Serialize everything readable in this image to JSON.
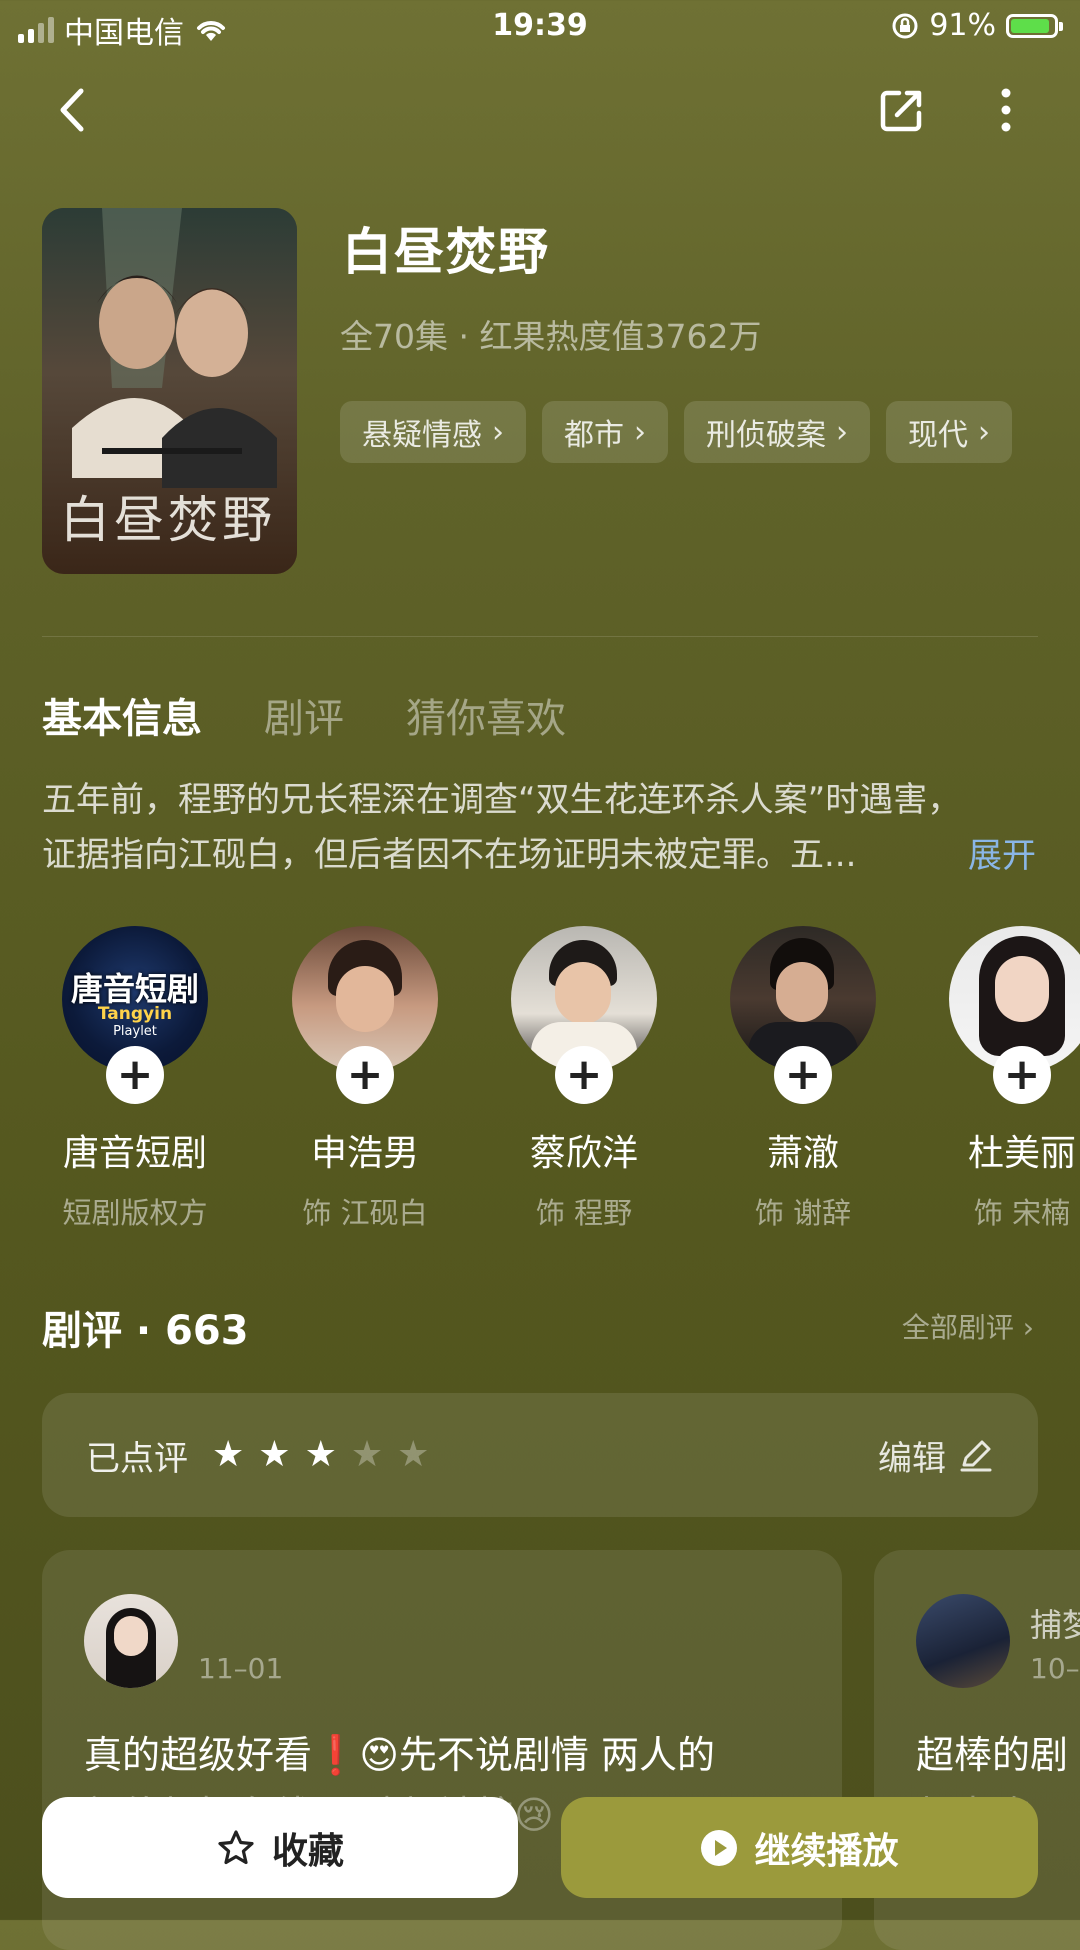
{
  "status_bar": {
    "carrier": "中国电信",
    "time": "19:39",
    "battery_percent": "91%",
    "battery_level": 0.91,
    "signal_bars": 4,
    "signal_active": 2
  },
  "drama": {
    "title": "白昼焚野",
    "subtitle": "全70集 · 红果热度值3762万",
    "poster_text": "白昼焚野",
    "tags": [
      "悬疑情感",
      "都市",
      "刑侦破案",
      "现代"
    ]
  },
  "tabs": [
    "基本信息",
    "剧评",
    "猜你喜欢"
  ],
  "active_tab": 0,
  "synopsis": {
    "line1": "五年前，程野的兄长程深在调查“双生花连环杀人案”时遇害，",
    "line2": "证据指向江砚白，但后者因不在场证明未被定罪。五...",
    "expand": "展开"
  },
  "cast": [
    {
      "name": "唐音短剧",
      "role": "短剧版权方",
      "logo_text": "唐音短剧",
      "logo_sub": "Tangyin",
      "logo_sub2": "Playlet"
    },
    {
      "name": "申浩男",
      "role": "饰 江砚白"
    },
    {
      "name": "蔡欣洋",
      "role": "饰 程野"
    },
    {
      "name": "萧澈",
      "role": "饰 谢辞"
    },
    {
      "name": "杜美丽",
      "role": "饰 宋楠"
    }
  ],
  "reviews": {
    "title": "剧评 · 663",
    "all_link": "全部剧评",
    "rated_label": "已点评",
    "rating": 3,
    "rating_max": 5,
    "edit_label": "编辑",
    "items": [
      {
        "date": "11–01",
        "text": "真的超级好看❗😍先不说剧情 两人的",
        "text2": "颜值都好在线 眼睛都被护😢"
      },
      {
        "name": "捕梦",
        "date": "10–",
        "text": "超棒的剧",
        "text2": "都喜欢"
      }
    ]
  },
  "buttons": {
    "favorite": "收藏",
    "play": "继续播放"
  },
  "colors": {
    "accent_play": "#9b9a3c",
    "link": "#8ab6e6",
    "battery": "#5ede4a"
  }
}
